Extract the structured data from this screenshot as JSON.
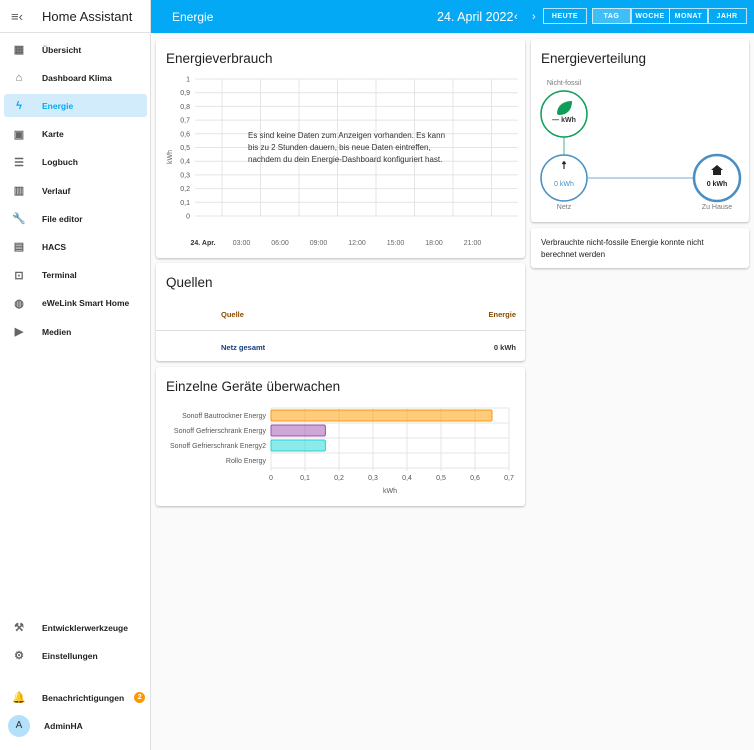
{
  "app": {
    "title": "Home Assistant"
  },
  "sidebar": {
    "items": [
      {
        "label": "Übersicht",
        "icon": "dashboard-icon"
      },
      {
        "label": "Dashboard Klima",
        "icon": "home-thermometer-icon"
      },
      {
        "label": "Energie",
        "icon": "lightning-icon",
        "active": true
      },
      {
        "label": "Karte",
        "icon": "map-icon"
      },
      {
        "label": "Logbuch",
        "icon": "list-icon"
      },
      {
        "label": "Verlauf",
        "icon": "chart-icon"
      },
      {
        "label": "File editor",
        "icon": "wrench-icon"
      },
      {
        "label": "HACS",
        "icon": "hacs-icon"
      },
      {
        "label": "Terminal",
        "icon": "terminal-icon"
      },
      {
        "label": "eWeLink Smart Home",
        "icon": "globe-icon"
      },
      {
        "label": "Medien",
        "icon": "media-icon"
      }
    ],
    "bottom": [
      {
        "label": "Entwicklerwerkzeuge",
        "icon": "hammer-icon"
      },
      {
        "label": "Einstellungen",
        "icon": "gear-icon"
      }
    ],
    "notifications": {
      "label": "Benachrichtigungen",
      "count": "2"
    },
    "user": {
      "label": "AdminHA",
      "initial": "A"
    }
  },
  "header": {
    "title": "Energie",
    "date": "24. April 2022",
    "today": "HEUTE",
    "periods": [
      "TAG",
      "WOCHE",
      "MONAT",
      "JAHR"
    ],
    "selected": "TAG",
    "accent": "#03a9f4"
  },
  "consumption": {
    "title": "Energieverbrauch",
    "message": [
      "Es sind keine Daten zum Anzeigen vorhanden. Es kann",
      "bis zu 2 Stunden dauern, bis neue Daten eintreffen,",
      "nachdem du dein Energie-Dashboard konfiguriert hast."
    ]
  },
  "sources": {
    "title": "Quellen",
    "col_source": "Quelle",
    "col_energy": "Energie",
    "rows": [
      {
        "name": "Netz gesamt",
        "value": "0 kWh"
      }
    ]
  },
  "devices": {
    "title": "Einzelne Geräte überwachen"
  },
  "distribution": {
    "title": "Energieverteilung",
    "fossil_label": "Nicht-fossil",
    "fossil_value": "— kWh",
    "grid_label": "Netz",
    "grid_value": "0 kWh",
    "home_label": "Zu Hause",
    "home_value": "0 kWh",
    "note": [
      "Verbrauchte nicht-fossile Energie konnte nicht",
      "berechnet werden"
    ]
  },
  "chart_data": [
    {
      "type": "bar",
      "title": "Energieverbrauch",
      "ylabel": "kWh",
      "ylim": [
        0,
        1
      ],
      "yticks": [
        "0",
        "0,1",
        "0,2",
        "0,3",
        "0,4",
        "0,5",
        "0,6",
        "0,7",
        "0,8",
        "0,9",
        "1"
      ],
      "categories": [
        "24. Apr.",
        "03:00",
        "06:00",
        "09:00",
        "12:00",
        "15:00",
        "18:00",
        "21:00"
      ],
      "values": [],
      "grid": true
    },
    {
      "type": "bar",
      "orientation": "horizontal",
      "title": "Einzelne Geräte überwachen",
      "xlabel": "kWh",
      "xlim": [
        0,
        0.7
      ],
      "xticks": [
        "0",
        "0,1",
        "0,2",
        "0,3",
        "0,4",
        "0,5",
        "0,6",
        "0,7"
      ],
      "categories": [
        "Sonoff Bautrockner Energy",
        "Sonoff Gefrierschrank Energy",
        "Sonoff Gefrierschrank Energy2",
        "Rollo Energy"
      ],
      "values": [
        0.65,
        0.16,
        0.16,
        0
      ],
      "colors": [
        "#ff9800",
        "#9c4fab",
        "#1dd5d5",
        "#888888"
      ],
      "grid": true
    }
  ]
}
